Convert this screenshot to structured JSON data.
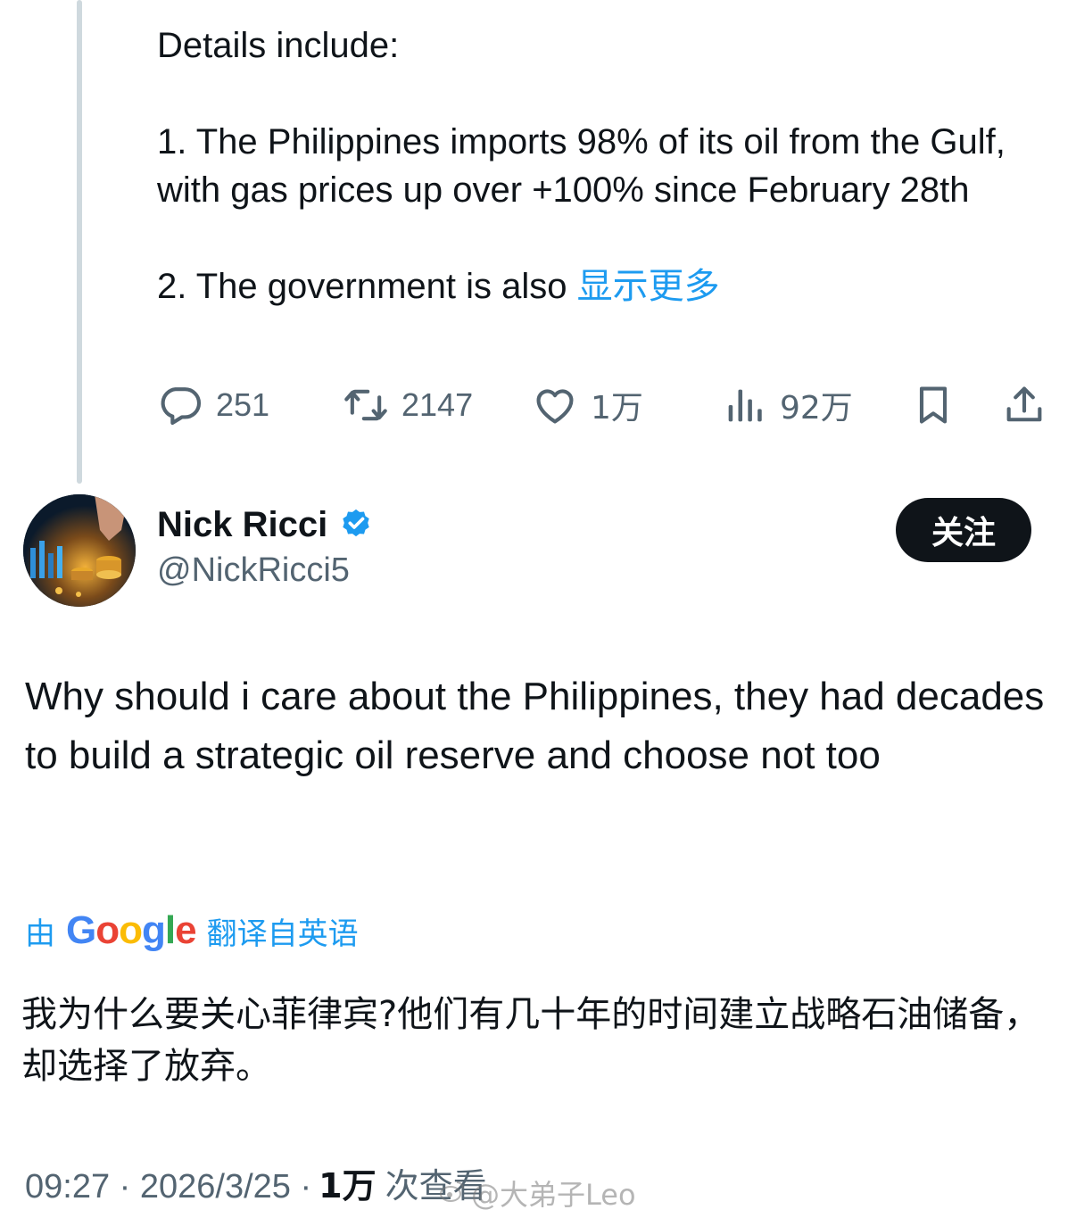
{
  "parent_tweet": {
    "intro": "Details include:",
    "point1": "1. The Philippines imports 98% of its oil from the Gulf, with gas prices up over +100% since February 28th",
    "point2": "2. The government is also",
    "show_more_label": "显示更多",
    "actions": {
      "replies": "251",
      "reposts": "2147",
      "likes": "1万",
      "views": "92万"
    }
  },
  "reply": {
    "display_name": "Nick Ricci",
    "handle": "@NickRicci5",
    "follow_label": "关注",
    "text": "Why should i care about the Philippines, they had decades to build a strategic oil reserve and choose not too",
    "translation": {
      "prefix": "由",
      "provider": "Google",
      "suffix": "翻译自英语",
      "text": "我为什么要关心菲律宾?他们有几十年的时间建立战略石油储备，却选择了放弃。"
    },
    "timestamp": "09:27 · 2026/3/25 · ",
    "views_count": "1万",
    "views_label": "次查看"
  },
  "watermark": "@大弟子Leo",
  "colors": {
    "accent": "#1d9bf0",
    "text": "#0f1419",
    "secondary": "#536471",
    "verified": "#1d9bf0",
    "google_blue": "#4285F4",
    "google_red": "#EA4335",
    "google_yellow": "#FBBC05",
    "google_green": "#34A853"
  },
  "icons": {
    "reply": "reply-icon",
    "repost": "repost-icon",
    "like": "heart-icon",
    "views": "views-icon",
    "bookmark": "bookmark-icon",
    "share": "share-icon",
    "verified": "verified-badge-icon"
  }
}
